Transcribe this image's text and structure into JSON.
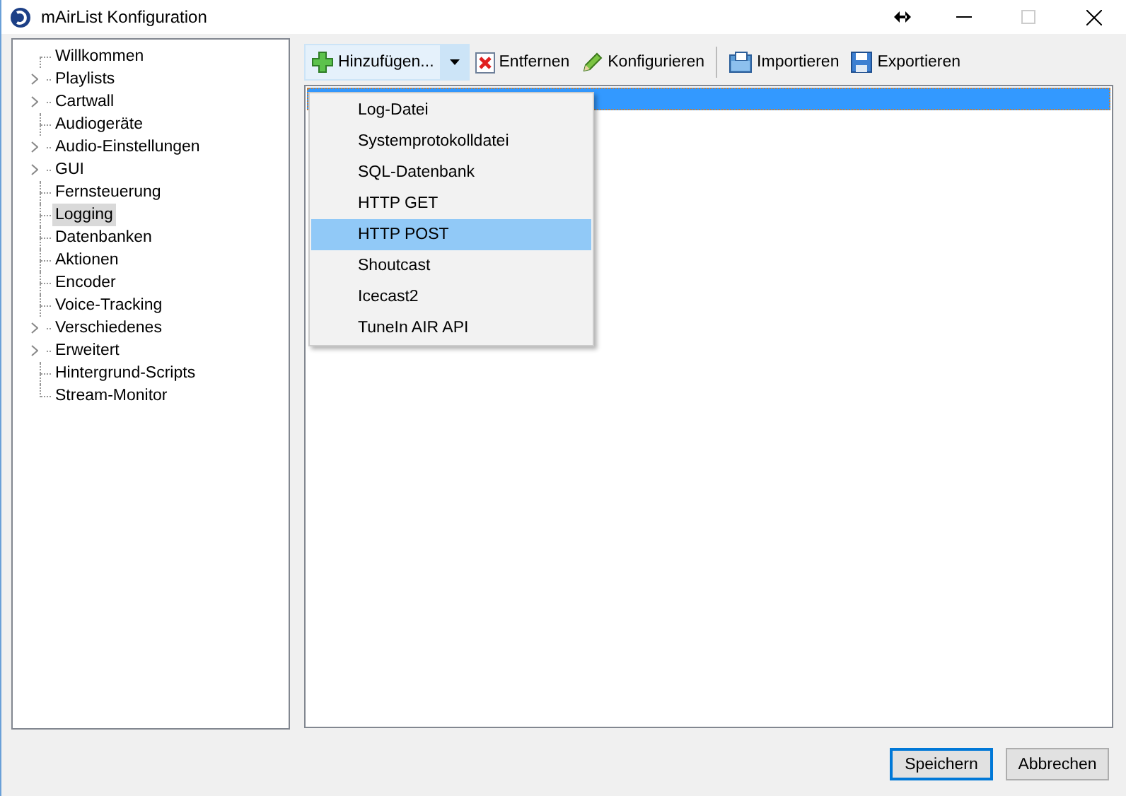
{
  "window": {
    "title": "mAirList Konfiguration"
  },
  "tree": {
    "items": [
      {
        "label": "Willkommen",
        "expandable": false,
        "selected": false
      },
      {
        "label": "Playlists",
        "expandable": true,
        "selected": false
      },
      {
        "label": "Cartwall",
        "expandable": true,
        "selected": false
      },
      {
        "label": "Audiogeräte",
        "expandable": false,
        "selected": false
      },
      {
        "label": "Audio-Einstellungen",
        "expandable": true,
        "selected": false
      },
      {
        "label": "GUI",
        "expandable": true,
        "selected": false
      },
      {
        "label": "Fernsteuerung",
        "expandable": false,
        "selected": false
      },
      {
        "label": "Logging",
        "expandable": false,
        "selected": true
      },
      {
        "label": "Datenbanken",
        "expandable": false,
        "selected": false
      },
      {
        "label": "Aktionen",
        "expandable": false,
        "selected": false
      },
      {
        "label": "Encoder",
        "expandable": false,
        "selected": false
      },
      {
        "label": "Voice-Tracking",
        "expandable": false,
        "selected": false
      },
      {
        "label": "Verschiedenes",
        "expandable": true,
        "selected": false
      },
      {
        "label": "Erweitert",
        "expandable": true,
        "selected": false
      },
      {
        "label": "Hintergrund-Scripts",
        "expandable": false,
        "selected": false
      },
      {
        "label": "Stream-Monitor",
        "expandable": false,
        "selected": false
      }
    ]
  },
  "toolbar": {
    "buttons": [
      {
        "label": "Hinzufügen...",
        "kind": "add"
      },
      {
        "label": "Entfernen",
        "kind": "remove"
      },
      {
        "label": "Konfigurieren",
        "kind": "configure"
      },
      {
        "label": "Importieren",
        "kind": "import"
      },
      {
        "label": "Exportieren",
        "kind": "export"
      }
    ]
  },
  "list": {
    "rows": [
      {
        "selected": true
      }
    ]
  },
  "menu": {
    "items": [
      {
        "label": "Log-Datei",
        "selected": false
      },
      {
        "label": "Systemprotokolldatei",
        "selected": false
      },
      {
        "label": "SQL-Datenbank",
        "selected": false
      },
      {
        "label": "HTTP GET",
        "selected": false
      },
      {
        "label": "HTTP POST",
        "selected": true
      },
      {
        "label": "Shoutcast",
        "selected": false
      },
      {
        "label": "Icecast2",
        "selected": false
      },
      {
        "label": "TuneIn AIR API",
        "selected": false
      }
    ]
  },
  "buttons": [
    {
      "label": "Speichern",
      "kind": "default"
    },
    {
      "label": "Abbrechen",
      "kind": "normal"
    }
  ]
}
